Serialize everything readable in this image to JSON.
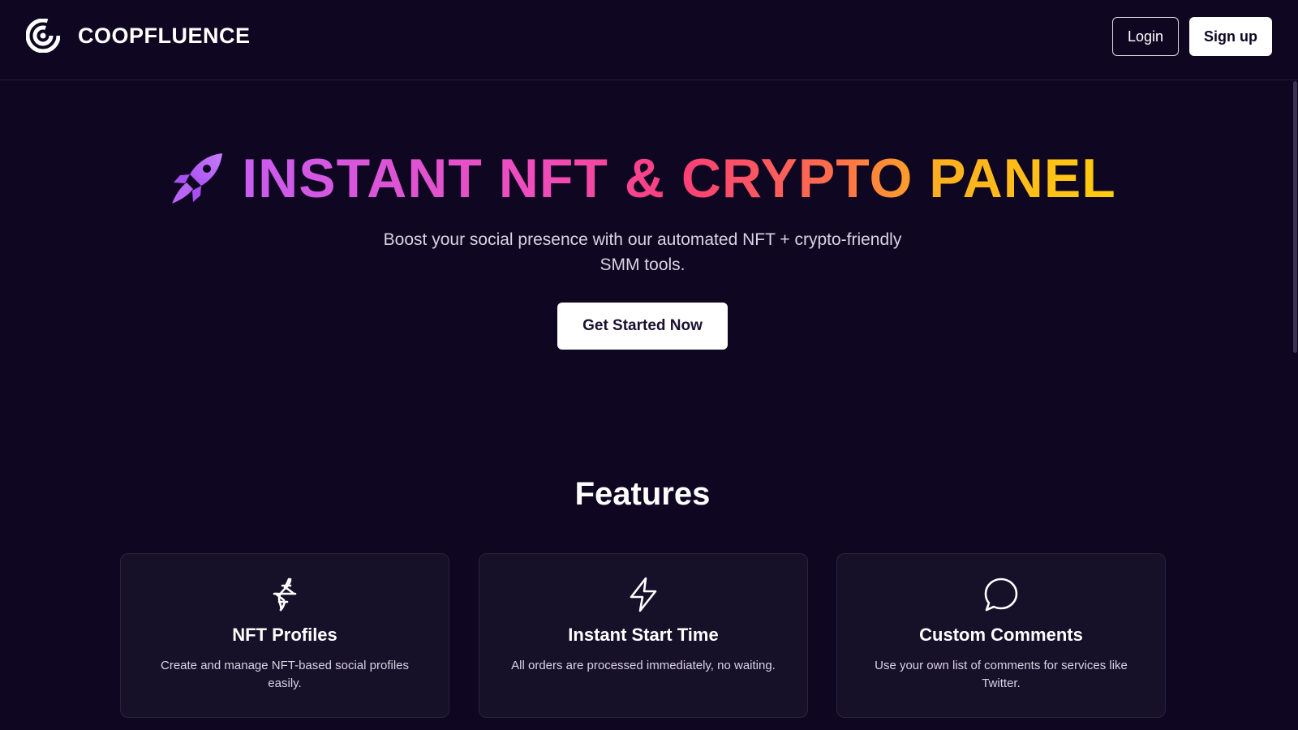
{
  "header": {
    "brand_name": "COOPFLUENCE",
    "login_label": "Login",
    "signup_label": "Sign up"
  },
  "hero": {
    "title": "INSTANT NFT & CRYPTO PANEL",
    "subtitle": "Boost your social presence with our automated NFT + crypto-friendly SMM tools.",
    "cta_label": "Get Started Now",
    "icon": "rocket-icon"
  },
  "features": {
    "heading": "Features",
    "items": [
      {
        "icon": "dna-icon",
        "title": "NFT Profiles",
        "description": "Create and manage NFT-based social profiles easily."
      },
      {
        "icon": "lightning-icon",
        "title": "Instant Start Time",
        "description": "All orders are processed immediately, no waiting."
      },
      {
        "icon": "chat-bubble-icon",
        "title": "Custom Comments",
        "description": "Use your own list of comments for services like Twitter."
      }
    ]
  },
  "colors": {
    "background": "#0f0722",
    "card_background": "#171029",
    "gradient": [
      "#c95cf0",
      "#f04cb8",
      "#fa3f78",
      "#ff6f4a",
      "#ffb01f",
      "#ffcc10"
    ]
  }
}
